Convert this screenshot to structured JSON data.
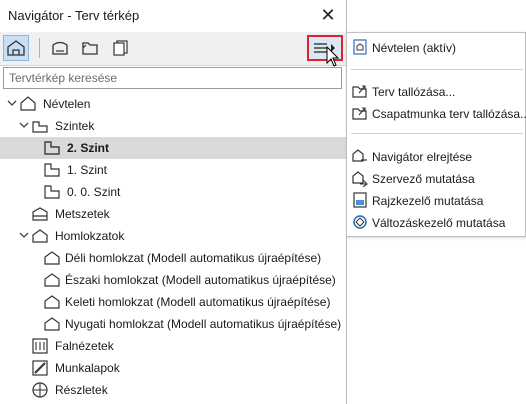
{
  "window": {
    "title": "Navigátor - Terv térkép",
    "close_glyph": "✕"
  },
  "toolbar": {
    "buttons": [
      "home-plan-icon",
      "layout-book-icon",
      "folder-link-icon",
      "publisher-sets-icon"
    ],
    "menu_button_icon": "hamburger-menu-icon",
    "accent_color": "#e0212f"
  },
  "search": {
    "placeholder": "Tervtérkép keresése",
    "value": ""
  },
  "tree": {
    "root": "Névtelen",
    "stories_group": "Szintek",
    "stories": [
      "2. Szint",
      "1. Szint",
      "0. 0. Szint"
    ],
    "selected": "2. Szint",
    "sections": "Metszetek",
    "elevations_group": "Homlokzatok",
    "elevations": [
      "Déli homlokzat (Modell automatikus újraépítése)",
      "Északi homlokzat (Modell automatikus újraépítése)",
      "Keleti homlokzat (Modell automatikus újraépítése)",
      "Nyugati homlokzat (Modell automatikus újraépítése)"
    ],
    "interior_elevations": "Falnézetek",
    "worksheets": "Munkalapok",
    "details": "Részletek"
  },
  "menu": {
    "active_project": "Névtelen (aktív)",
    "browse_project": "Terv tallózása...",
    "browse_teamwork": "Csapatmunka terv tallózása...",
    "hide_navigator": "Navigátor elrejtése",
    "show_organizer": "Szervező mutatása",
    "show_drawing_manager": "Rajzkezelő mutatása",
    "show_change_manager": "Változáskezelő mutatása"
  }
}
